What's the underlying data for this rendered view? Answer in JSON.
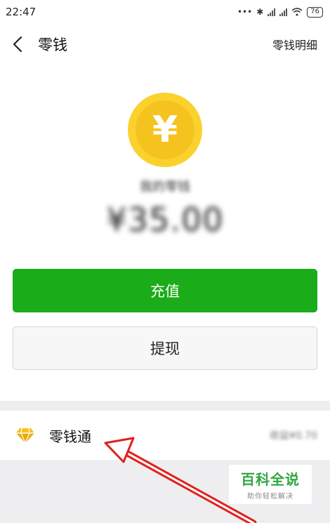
{
  "status_bar": {
    "time": "22:47",
    "battery": "76"
  },
  "header": {
    "title": "零钱",
    "detail_link": "零钱明细"
  },
  "balance": {
    "coin_symbol": "¥",
    "label": "我的零钱",
    "amount": "¥35.00"
  },
  "actions": {
    "recharge_label": "充值",
    "withdraw_label": "提现"
  },
  "lingqiantong": {
    "label": "零钱通",
    "value": "收益¥0.70"
  },
  "watermark": {
    "title": "百科全说",
    "subtitle": "助你轻松解决"
  },
  "colors": {
    "primary_green": "#1aad19",
    "coin_yellow": "#fbd12e",
    "annotation_red": "#e0201c"
  },
  "icons": [
    "back-arrow-icon",
    "bluetooth-icon",
    "signal-icon",
    "wifi-icon",
    "battery-icon",
    "yen-coin-icon",
    "diamond-icon"
  ]
}
